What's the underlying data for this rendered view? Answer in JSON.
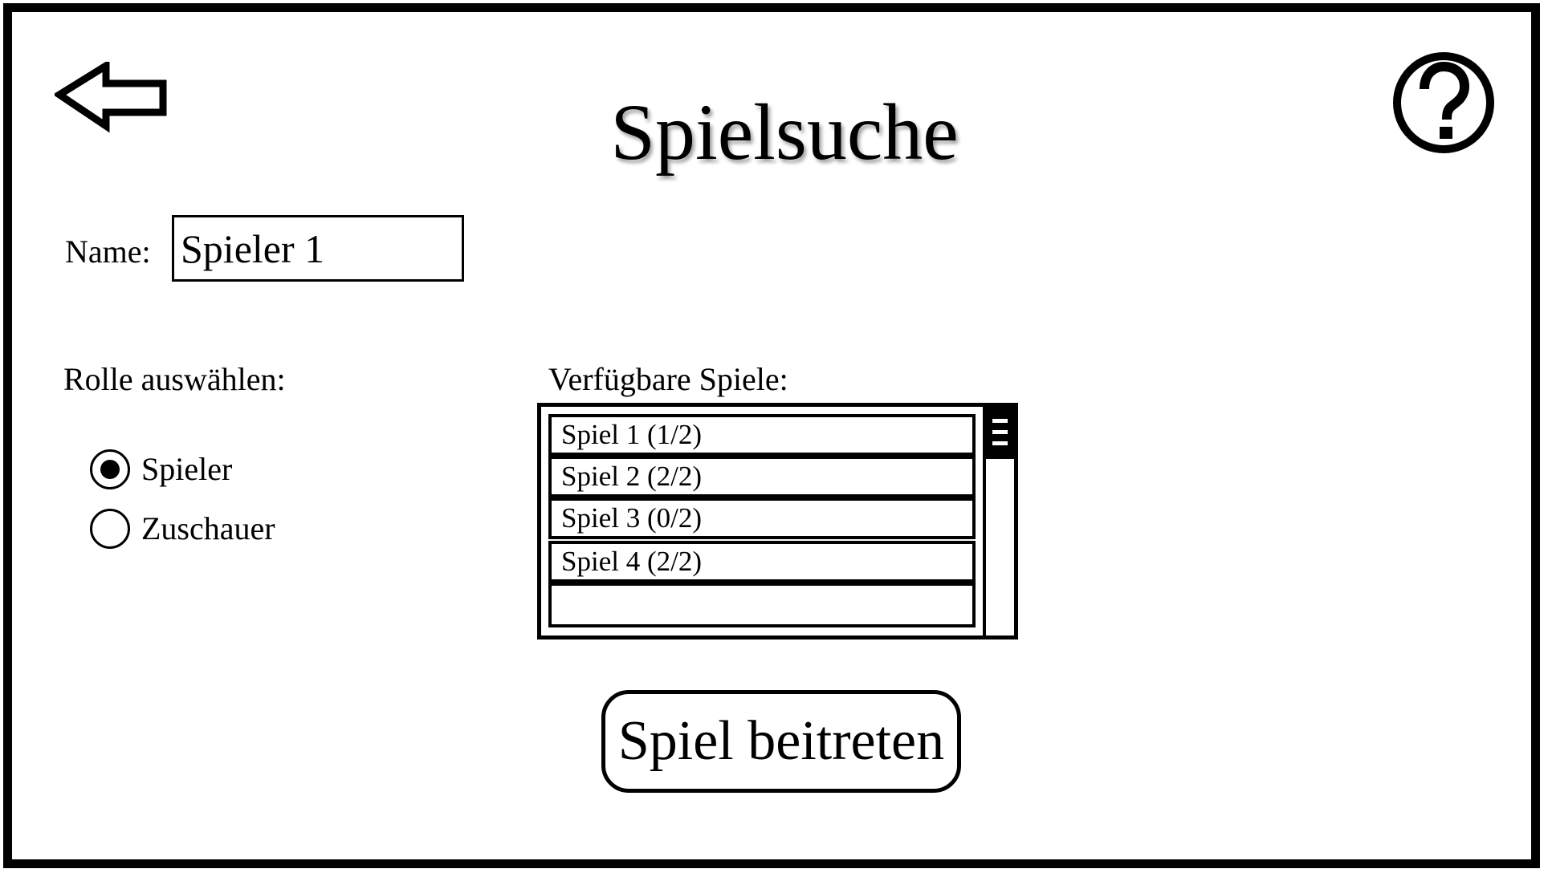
{
  "header": {
    "title": "Spielsuche",
    "back_icon": "arrow-left-icon",
    "help_icon": "question-circle-icon"
  },
  "name_field": {
    "label": "Name:",
    "value": "Spieler 1"
  },
  "role": {
    "label": "Rolle auswählen:",
    "options": [
      {
        "label": "Spieler",
        "selected": true
      },
      {
        "label": "Zuschauer",
        "selected": false
      }
    ]
  },
  "games": {
    "label": "Verfügbare Spiele:",
    "items": [
      {
        "label": "Spiel 1 (1/2)"
      },
      {
        "label": "Spiel 2 (2/2)"
      },
      {
        "label": "Spiel 3 (0/2)"
      },
      {
        "label": "Spiel 4 (2/2)"
      },
      {
        "label": ""
      }
    ]
  },
  "join_button": {
    "label": "Spiel beitreten"
  }
}
